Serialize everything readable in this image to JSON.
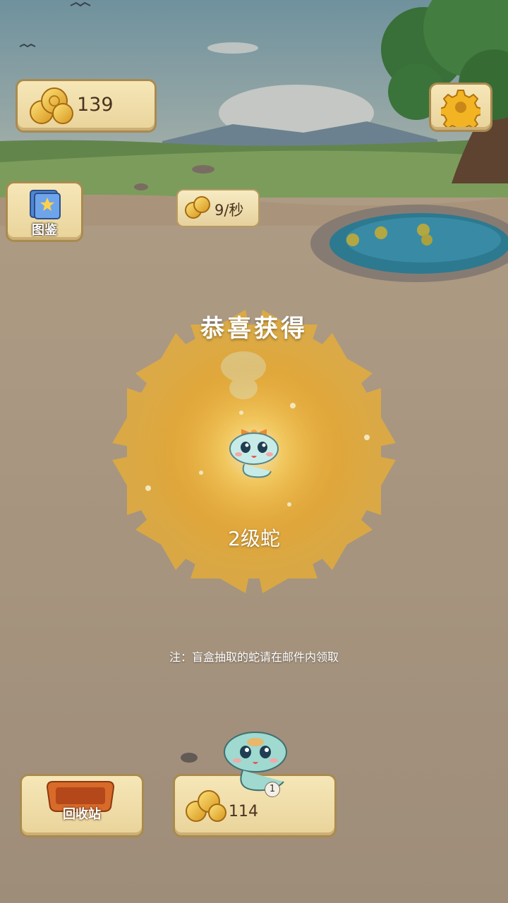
{
  "hud": {
    "coins": "139",
    "income_rate": "9/秒",
    "handbook_label": "图鉴"
  },
  "reward": {
    "title": "恭喜获得",
    "item_name": "2级蛇",
    "note": "注：盲盒抽取的蛇请在邮件内领取"
  },
  "bottom": {
    "recycle_label": "回收站",
    "buy_price": "114",
    "buy_badge": "1"
  },
  "icons": {
    "coin": "coin-stack-icon",
    "settings": "gear-icon",
    "handbook": "book-icon",
    "recycle": "recycle-bin-icon"
  },
  "colors": {
    "panel": "#efdcaa",
    "glow": "#ffb21e",
    "snake": "#bfe8e4"
  }
}
